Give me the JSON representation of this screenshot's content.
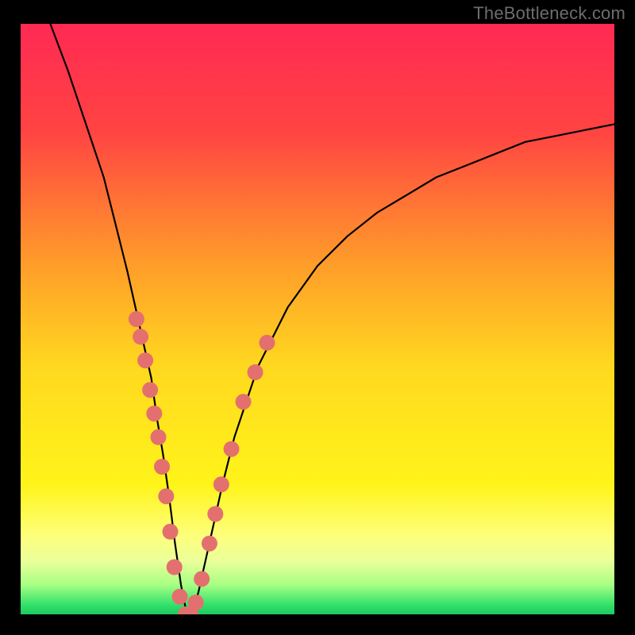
{
  "watermark": "TheBottleneck.com",
  "chart_data": {
    "type": "line",
    "title": "",
    "xlabel": "",
    "ylabel": "",
    "xlim": [
      0,
      100
    ],
    "ylim": [
      0,
      100
    ],
    "series": [
      {
        "name": "bottleneck-curve",
        "x": [
          5,
          8,
          11,
          14,
          16,
          18,
          20,
          22,
          23,
          24,
          25,
          26,
          27,
          28,
          29,
          30,
          32,
          34,
          36,
          40,
          45,
          50,
          55,
          60,
          65,
          70,
          75,
          80,
          85,
          90,
          95,
          100
        ],
        "y": [
          100,
          92,
          83,
          74,
          66,
          58,
          49,
          40,
          33,
          27,
          20,
          12,
          5,
          0,
          0,
          4,
          13,
          22,
          30,
          42,
          52,
          59,
          64,
          68,
          71,
          74,
          76,
          78,
          80,
          81,
          82,
          83
        ]
      }
    ],
    "background_gradient": {
      "stops": [
        {
          "offset": 0.0,
          "color": "#ff2a53"
        },
        {
          "offset": 0.18,
          "color": "#ff4343"
        },
        {
          "offset": 0.4,
          "color": "#ff9a2a"
        },
        {
          "offset": 0.58,
          "color": "#ffd81f"
        },
        {
          "offset": 0.78,
          "color": "#fff41a"
        },
        {
          "offset": 0.87,
          "color": "#fdff7e"
        },
        {
          "offset": 0.91,
          "color": "#eaff9a"
        },
        {
          "offset": 0.95,
          "color": "#a7ff84"
        },
        {
          "offset": 0.985,
          "color": "#2fe06a"
        },
        {
          "offset": 1.0,
          "color": "#1fc95f"
        }
      ]
    },
    "highlight_points": {
      "color": "#e46f6f",
      "points": [
        {
          "x": 19.5,
          "y": 50
        },
        {
          "x": 20.2,
          "y": 47
        },
        {
          "x": 21.0,
          "y": 43
        },
        {
          "x": 21.8,
          "y": 38
        },
        {
          "x": 22.5,
          "y": 34
        },
        {
          "x": 23.2,
          "y": 30
        },
        {
          "x": 23.8,
          "y": 25
        },
        {
          "x": 24.5,
          "y": 20
        },
        {
          "x": 25.2,
          "y": 14
        },
        {
          "x": 25.9,
          "y": 8
        },
        {
          "x": 26.8,
          "y": 3
        },
        {
          "x": 27.8,
          "y": 0
        },
        {
          "x": 28.6,
          "y": 0
        },
        {
          "x": 29.5,
          "y": 2
        },
        {
          "x": 30.5,
          "y": 6
        },
        {
          "x": 31.8,
          "y": 12
        },
        {
          "x": 32.8,
          "y": 17
        },
        {
          "x": 33.8,
          "y": 22
        },
        {
          "x": 35.5,
          "y": 28
        },
        {
          "x": 37.5,
          "y": 36
        },
        {
          "x": 39.5,
          "y": 41
        },
        {
          "x": 41.5,
          "y": 46
        }
      ]
    }
  }
}
